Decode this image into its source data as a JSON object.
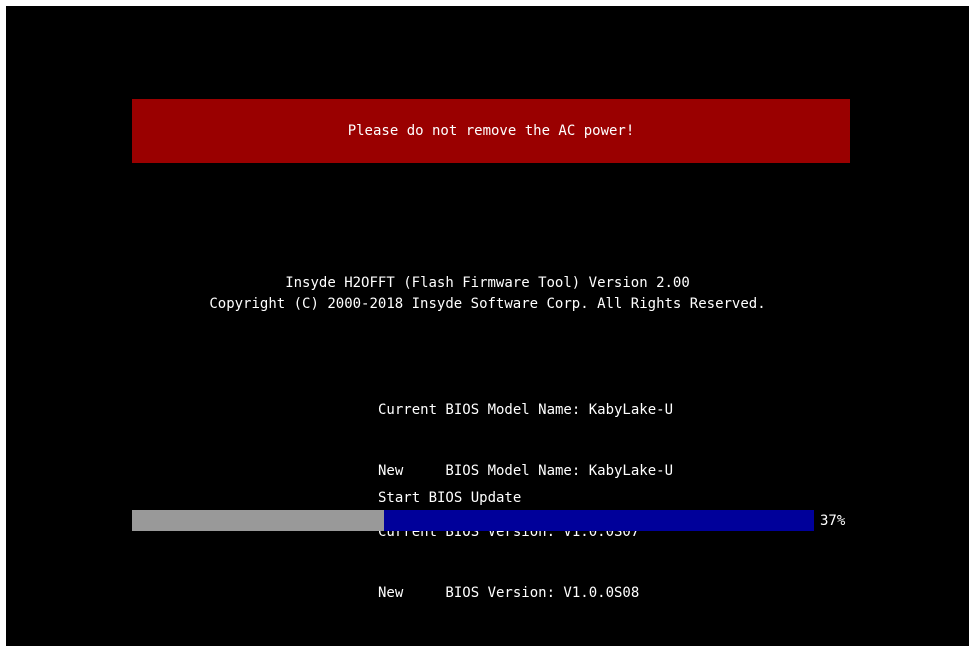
{
  "warning": {
    "text": "Please do not remove the AC power!",
    "bg_color": "#9a0000"
  },
  "tool": {
    "title": "Insyde H2OFFT (Flash Firmware Tool) Version 2.00",
    "copyright": "Copyright (C) 2000-2018 Insyde Software Corp. All Rights Reserved."
  },
  "bios_info": {
    "lines": [
      "Current BIOS Model Name: KabyLake-U",
      "New     BIOS Model Name: KabyLake-U",
      "Current BIOS Version: V1.0.0S07",
      "New     BIOS Version: V1.0.0S08"
    ]
  },
  "update": {
    "status_label": "Start BIOS Update",
    "progress_fraction": 0.37,
    "progress_text": "37%",
    "track_color": "#00009a",
    "fill_color": "#999999"
  }
}
